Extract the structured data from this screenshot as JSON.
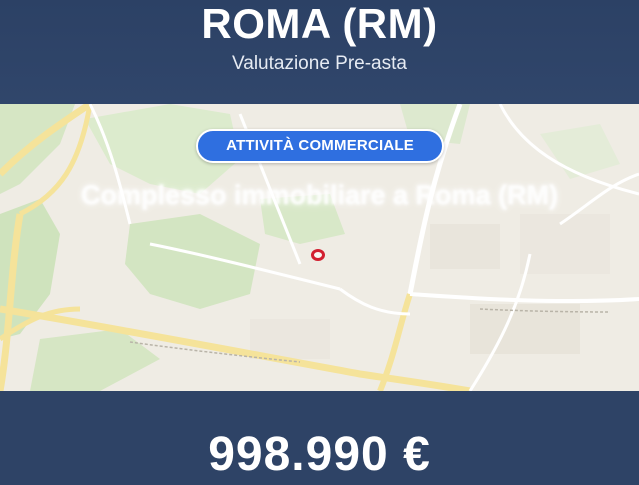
{
  "header": {
    "city": "ROMA (RM)",
    "subtitle": "Valutazione Pre-asta"
  },
  "listing": {
    "category": "ATTIVITÀ COMMERCIALE",
    "title": "Complesso immobiliare a Roma (RM)",
    "price": "998.990 €"
  },
  "map": {
    "marker_icon": "map-pin-icon",
    "colors": {
      "land": "#efece4",
      "park": "#cfe3bd",
      "major_road": "#f5e39a",
      "minor_road": "#ffffff",
      "marker": "#d22030"
    }
  },
  "theme": {
    "header_bg": "#2e4366",
    "badge_bg": "#2f6fe0"
  }
}
